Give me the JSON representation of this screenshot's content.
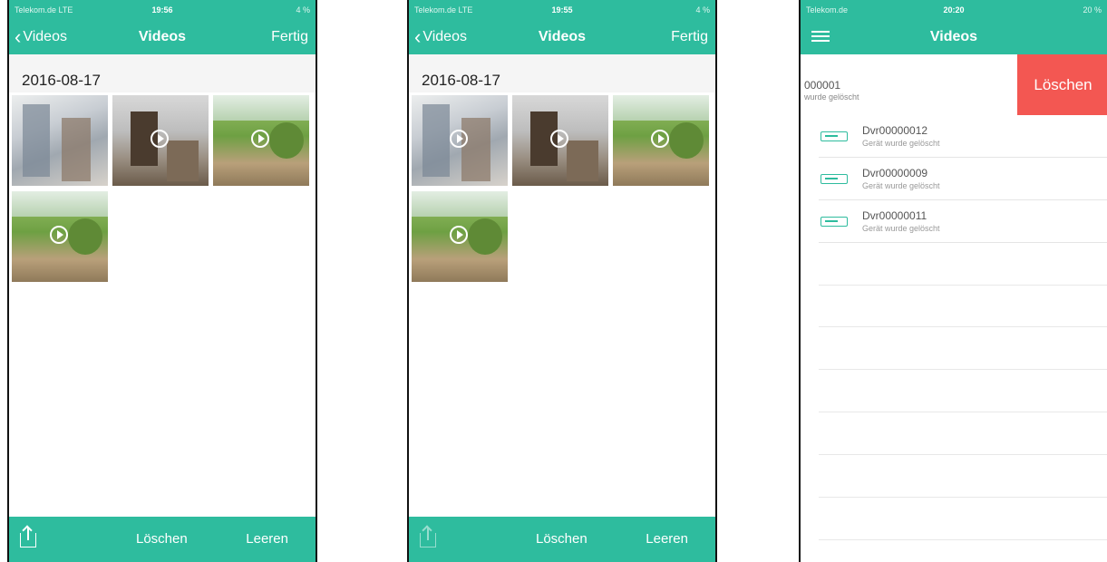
{
  "colors": {
    "accent": "#2ebc9e",
    "delete": "#f35752"
  },
  "phone1": {
    "status": {
      "carrier": "Telekom.de  LTE",
      "time": "19:56",
      "right": "4 %"
    },
    "nav": {
      "back": "Videos",
      "title": "Videos",
      "done": "Fertig"
    },
    "date": "2016-08-17",
    "thumbnails": [
      "people",
      "office",
      "garden",
      "garden"
    ],
    "toolbar": {
      "delete": "Löschen",
      "clear": "Leeren"
    }
  },
  "phone2": {
    "status": {
      "carrier": "Telekom.de  LTE",
      "time": "19:55",
      "right": "4 %"
    },
    "nav": {
      "back": "Videos",
      "title": "Videos",
      "done": "Fertig"
    },
    "date": "2016-08-17",
    "thumbnails": [
      "people",
      "office",
      "garden",
      "garden"
    ],
    "toolbar": {
      "delete": "Löschen",
      "clear": "Leeren"
    }
  },
  "phone3": {
    "status": {
      "carrier": "Telekom.de",
      "time": "20:20",
      "right": "20 %"
    },
    "nav": {
      "title": "Videos"
    },
    "swiped_row": {
      "name": "000001",
      "sub": "wurde gelöscht",
      "action": "Löschen"
    },
    "devices": [
      {
        "name": "Dvr00000012",
        "sub": "Gerät wurde gelöscht"
      },
      {
        "name": "Dvr00000009",
        "sub": "Gerät wurde gelöscht"
      },
      {
        "name": "Dvr00000011",
        "sub": "Gerät wurde gelöscht"
      }
    ]
  }
}
